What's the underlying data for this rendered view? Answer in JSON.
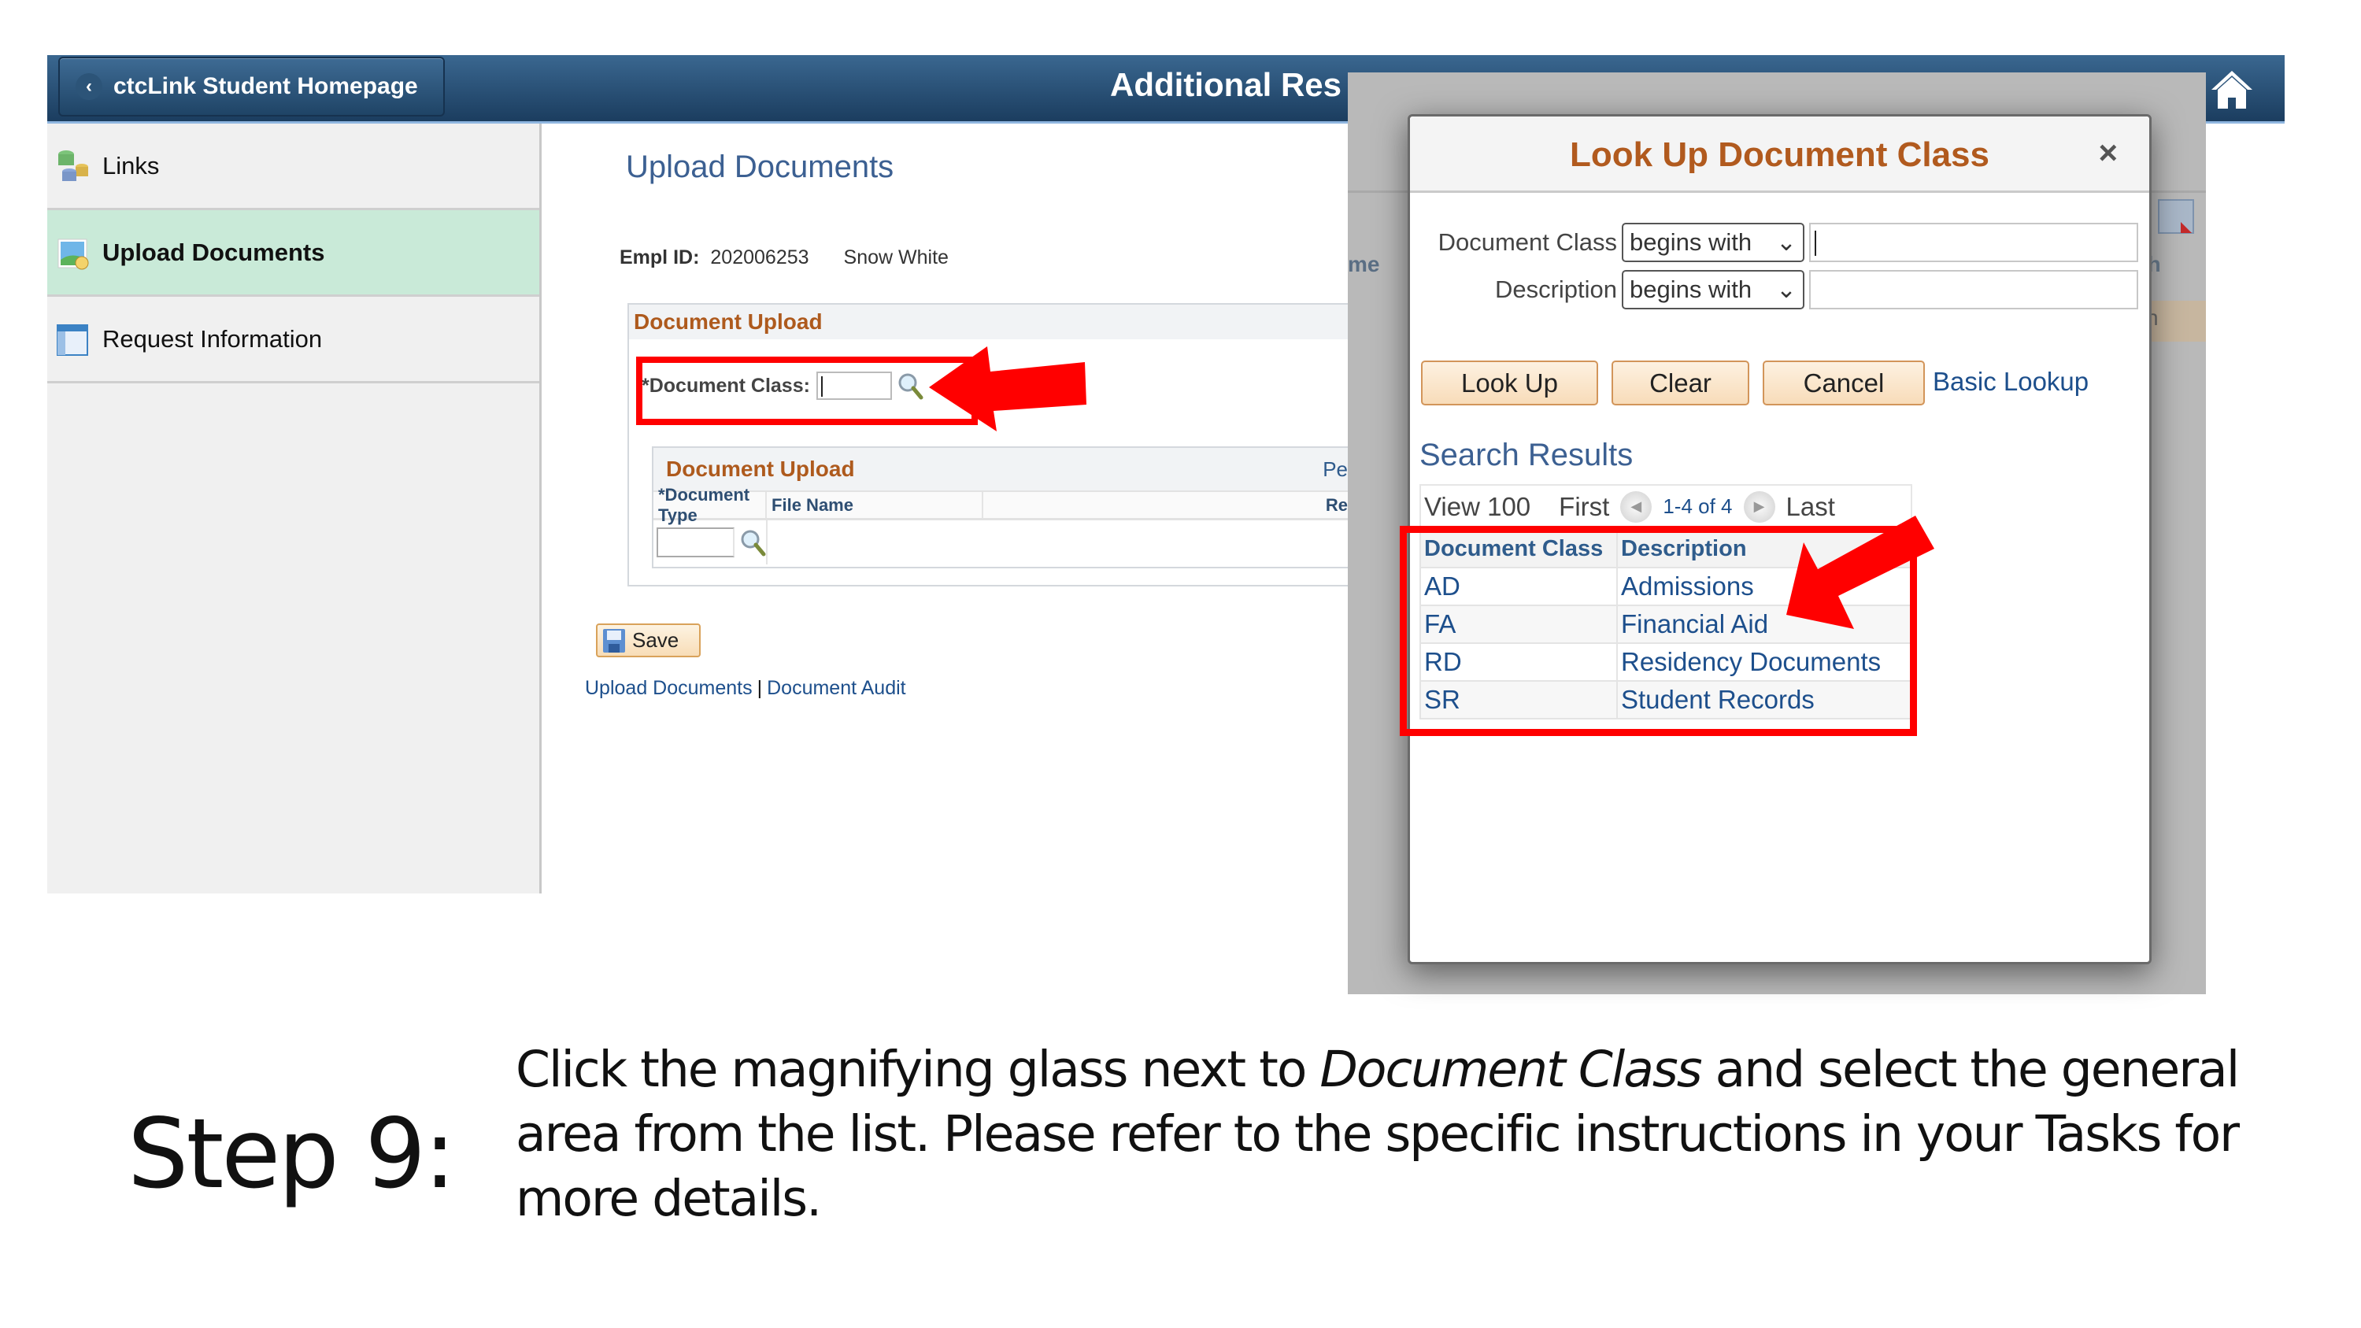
{
  "header": {
    "back_label": "ctcLink Student Homepage",
    "title": "Additional Res"
  },
  "sidebar": {
    "items": [
      {
        "label": "Links",
        "icon": "database-links-icon",
        "active": false
      },
      {
        "label": "Upload Documents",
        "icon": "upload-image-icon",
        "active": true
      },
      {
        "label": "Request Information",
        "icon": "form-window-icon",
        "active": false
      }
    ]
  },
  "main": {
    "title": "Upload Documents",
    "empl_id_label": "Empl ID:",
    "empl_id": "202006253",
    "name": "Snow White",
    "doc_upload_header": "Document Upload",
    "doc_class_label": "*Document Class:",
    "doc_class_value": "",
    "grid": {
      "title": "Document Upload",
      "right_label": "Pe",
      "columns": [
        "*Document Type",
        "File Name",
        "Re"
      ],
      "doc_type_value": ""
    },
    "save_label": "Save",
    "links": [
      "Upload Documents",
      "Document Audit"
    ],
    "link_separator": "|"
  },
  "background_ghost": {
    "col_fragment": "me",
    "right_fragment_1": "ch",
    "right_fragment_2": "ch"
  },
  "modal": {
    "title": "Look Up Document Class",
    "close": "×",
    "criteria": [
      {
        "label": "Document Class",
        "operator": "begins with",
        "value": ""
      },
      {
        "label": "Description",
        "operator": "begins with",
        "value": ""
      }
    ],
    "buttons": {
      "lookup": "Look Up",
      "clear": "Clear",
      "cancel": "Cancel"
    },
    "basic_lookup": "Basic Lookup",
    "results_title": "Search Results",
    "pager": {
      "view": "View 100",
      "first": "First",
      "range": "1-4 of 4",
      "last": "Last"
    },
    "table": {
      "columns": [
        "Document Class",
        "Description"
      ],
      "rows": [
        [
          "AD",
          "Admissions"
        ],
        [
          "FA",
          "Financial Aid"
        ],
        [
          "RD",
          "Residency Documents"
        ],
        [
          "SR",
          "Student Records"
        ]
      ]
    }
  },
  "instructions": {
    "step": "Step 9:",
    "text_before": "Click the magnifying glass next to ",
    "text_em": "Document Class",
    "text_after": " and select the general area from the list. Please refer to the specific instructions in your Tasks for more details."
  },
  "colors": {
    "header": "#1f4466",
    "accent_orange": "#b15a1e",
    "link_blue": "#1d4f8c",
    "active_green": "#c9ead8",
    "highlight_red": "#ff0000"
  }
}
